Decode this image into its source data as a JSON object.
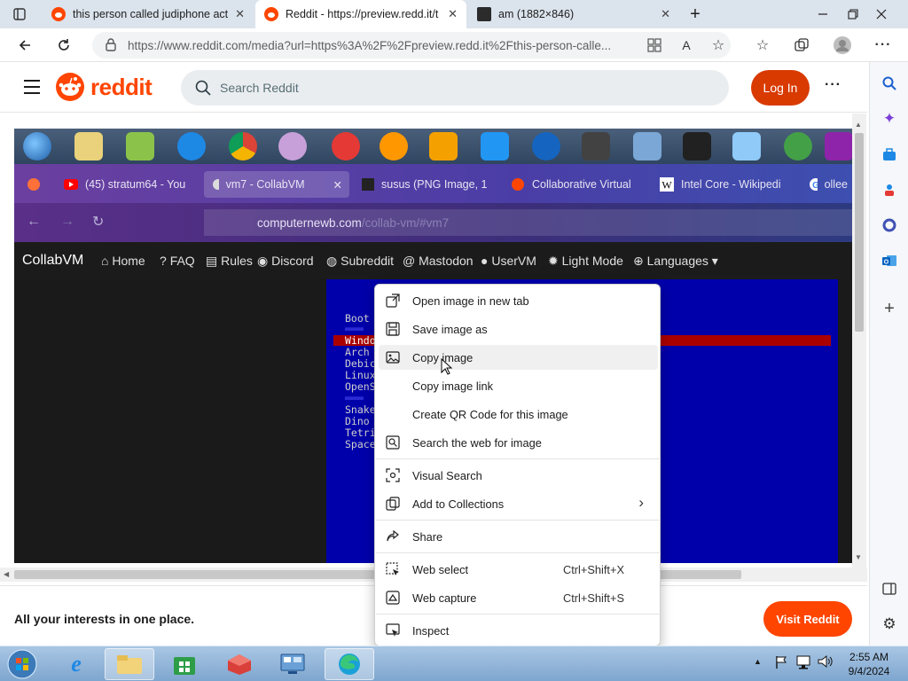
{
  "browser": {
    "tabs": [
      {
        "title": "this person called judiphone act",
        "close": "✕"
      },
      {
        "title": "Reddit - https://preview.redd.it/t",
        "close": "✕"
      },
      {
        "title": "am (1882×846)",
        "close": "✕"
      }
    ],
    "new_tab": "+",
    "url": "https://www.reddit.com/media?url=https%3A%2F%2Fpreview.redd.it%2Fthis-person-calle..."
  },
  "reddit": {
    "logo_text": "reddit",
    "search_placeholder": "Search Reddit",
    "login_label": "Log In",
    "more": "···",
    "banner_text": "All your interests in one place.",
    "visit_label": "Visit Reddit"
  },
  "embedded": {
    "firefox_tabs": [
      {
        "title": "(45) stratum64 - You"
      },
      {
        "title": "vm7 - CollabVM"
      },
      {
        "title": "susus (PNG Image, 1"
      },
      {
        "title": "Collaborative Virtual"
      },
      {
        "title": "Intel Core - Wikipedi"
      },
      {
        "title": "ollee"
      }
    ],
    "url_host": "computernewb.com",
    "url_path": "/collab-vm/#vm7",
    "collabvm_brand": "CollabVM",
    "collabvm_nav": [
      "Home",
      "FAQ",
      "Rules",
      "Discord",
      "Subreddit",
      "Mastodon",
      "UserVM",
      "Light Mode",
      "Languages"
    ],
    "boot_lines": [
      "Boot",
      "Windo",
      "Arch",
      "Debic",
      "Linux",
      "OpenS",
      "Snake",
      "Dino",
      "Tetri",
      "Space"
    ]
  },
  "context_menu": {
    "items": [
      {
        "label": "Open image in new tab",
        "icon": "open-new-tab-icon"
      },
      {
        "label": "Save image as",
        "icon": "save-icon"
      },
      {
        "label": "Copy image",
        "icon": "image-icon"
      },
      {
        "label": "Copy image link",
        "icon": ""
      },
      {
        "label": "Create QR Code for this image",
        "icon": ""
      },
      {
        "label": "Search the web for image",
        "icon": "search-web-icon"
      },
      {
        "label": "Visual Search",
        "icon": "visual-search-icon"
      },
      {
        "label": "Add to Collections",
        "icon": "collections-icon"
      },
      {
        "label": "Share",
        "icon": "share-icon"
      },
      {
        "label": "Web select",
        "icon": "web-select-icon",
        "shortcut": "Ctrl+Shift+X"
      },
      {
        "label": "Web capture",
        "icon": "web-capture-icon",
        "shortcut": "Ctrl+Shift+S"
      },
      {
        "label": "Inspect",
        "icon": "inspect-icon"
      }
    ],
    "submenu_arrow": "›"
  },
  "taskbar": {
    "time": "2:55 AM",
    "date": "9/4/2024"
  },
  "colors": {
    "reddit_orange": "#ff4500",
    "login_button": "#d93a00",
    "vm_screen_blue": "#0000aa",
    "vm_highlight_red": "#aa0000"
  }
}
